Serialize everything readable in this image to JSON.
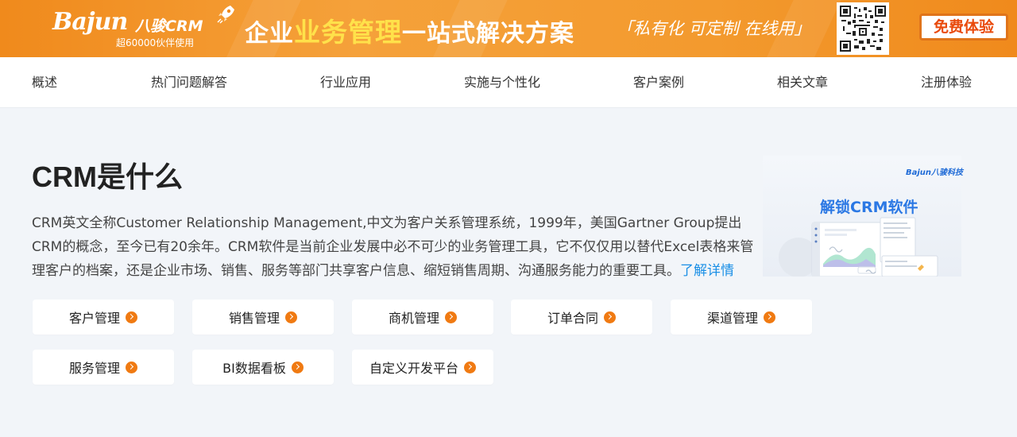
{
  "banner": {
    "brand": "Bajun",
    "brand_cn": "八骏CRM",
    "users": "超60000伙伴使用",
    "slogan_pre": "企业",
    "slogan_highlight": "业务管理",
    "slogan_post": "一站式解决方案",
    "tagline": "「私有化 可定制 在线用」",
    "free_trial": "免费体验",
    "colors": {
      "bg": "#f08a1c",
      "highlight": "#ffe14a",
      "button_text": "#e94a0c"
    }
  },
  "nav": {
    "items": [
      "概述",
      "热门问题解答",
      "行业应用",
      "实施与个性化",
      "客户案例",
      "相关文章",
      "注册体验"
    ]
  },
  "main": {
    "title": "CRM是什么",
    "description": "CRM英文全称Customer Relationship Management,中文为客户关系管理系统，1999年，美国Gartner Group提出CRM的概念，至今已有20余年。CRM软件是当前企业发展中必不可少的业务管理工具，它不仅仅用以替代Excel表格来管理客户的档案，还是企业市场、销售、服务等部门共享客户信息、缩短销售周期、沟通服务能力的重要工具。",
    "more_link": "了解详情",
    "link_color": "#1a8fe6"
  },
  "illustration": {
    "logo": "Bajun八骏科技",
    "title": "解锁CRM软件"
  },
  "modules": [
    "客户管理",
    "销售管理",
    "商机管理",
    "订单合同",
    "渠道管理",
    "服务管理",
    "BI数据看板",
    "自定义开发平台"
  ],
  "accent": "#f07a12"
}
